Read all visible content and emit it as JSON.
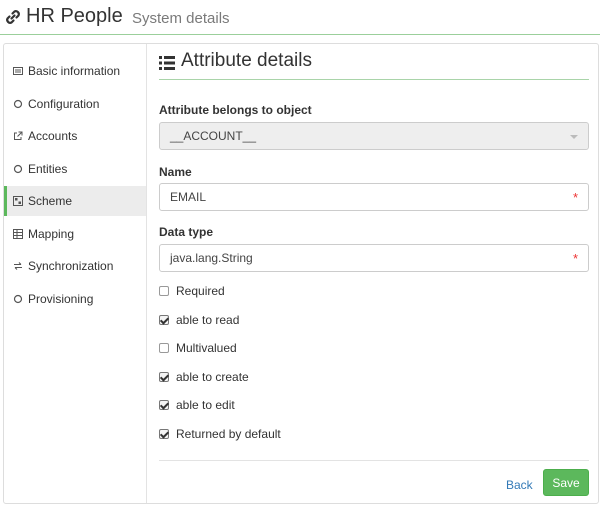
{
  "header": {
    "title": "HR People",
    "subtitle": "System details",
    "icon": "link-icon"
  },
  "sidebar": {
    "items": [
      {
        "label": "Basic information",
        "icon": "card-icon"
      },
      {
        "label": "Configuration",
        "icon": "circle-icon"
      },
      {
        "label": "Accounts",
        "icon": "external-link-icon"
      },
      {
        "label": "Entities",
        "icon": "circle-icon"
      },
      {
        "label": "Scheme",
        "icon": "scheme-icon",
        "active": true
      },
      {
        "label": "Mapping",
        "icon": "table-icon"
      },
      {
        "label": "Synchronization",
        "icon": "exchange-icon"
      },
      {
        "label": "Provisioning",
        "icon": "circle-icon"
      }
    ]
  },
  "content": {
    "title": "Attribute details",
    "object_label": "Attribute belongs to object",
    "object_value": "__ACCOUNT__",
    "name_label": "Name",
    "name_value": "EMAIL",
    "datatype_label": "Data type",
    "datatype_value": "java.lang.String",
    "required_marker": "*",
    "checkboxes": [
      {
        "label": "Required",
        "checked": false
      },
      {
        "label": "able to read",
        "checked": true
      },
      {
        "label": "Multivalued",
        "checked": false
      },
      {
        "label": "able to create",
        "checked": true
      },
      {
        "label": "able to edit",
        "checked": true
      },
      {
        "label": "Returned by default",
        "checked": true
      }
    ]
  },
  "actions": {
    "back_label": "Back",
    "save_label": "Save"
  },
  "colors": {
    "accent": "#5cb85c",
    "link": "#337ab7",
    "required": "#e33333"
  }
}
